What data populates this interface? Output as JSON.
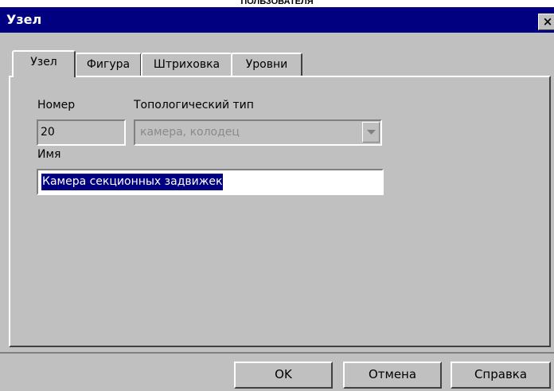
{
  "page_header": "ПОЛЬЗОВАТЕЛЯ",
  "window": {
    "title": "Узел",
    "close_label": "×"
  },
  "tabs": [
    {
      "label": "Узел",
      "active": true
    },
    {
      "label": "Фигура",
      "active": false
    },
    {
      "label": "Штриховка",
      "active": false
    },
    {
      "label": "Уровни",
      "active": false
    }
  ],
  "form": {
    "number_label": "Номер",
    "number_value": "20",
    "type_label": "Топологический тип",
    "type_value": "камера, колодец",
    "name_label": "Имя",
    "name_value": "Камера секционных задвижек"
  },
  "buttons": {
    "ok": "OK",
    "cancel": "Отмена",
    "help": "Справка"
  },
  "colors": {
    "titlebar": "#000080",
    "face": "#c0c0c0",
    "selection": "#000080"
  },
  "icons": {
    "close": "close-icon",
    "dropdown": "chevron-down-icon"
  }
}
